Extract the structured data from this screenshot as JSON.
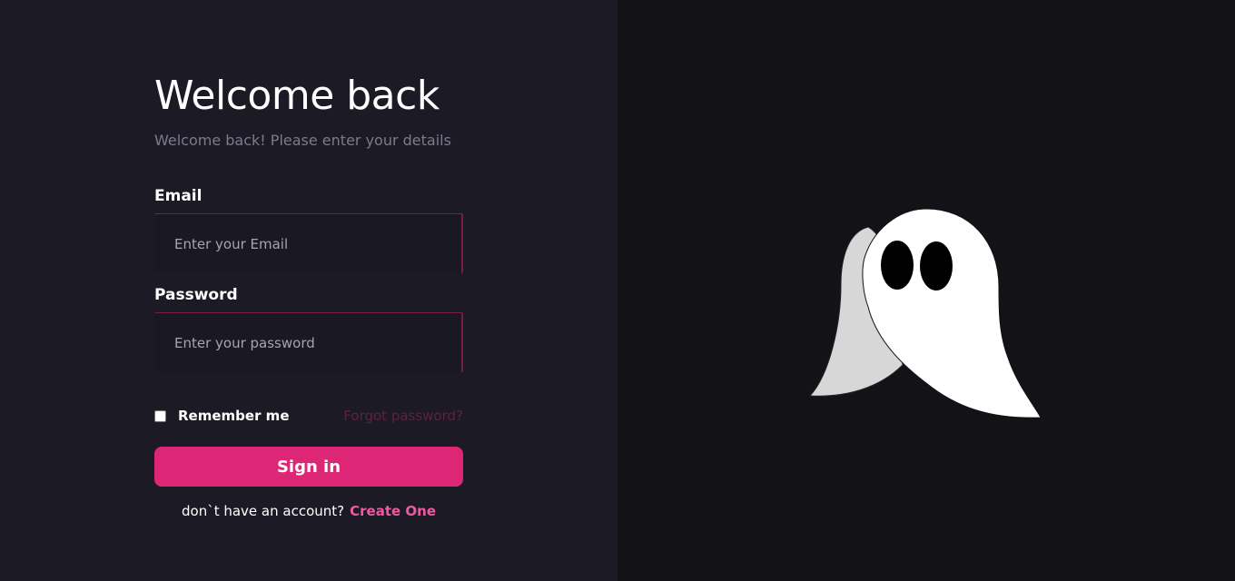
{
  "login": {
    "title": "Welcome back",
    "subtitle": "Welcome back! Please enter your details",
    "email_label": "Email",
    "email_placeholder": "Enter your Email",
    "email_value": "",
    "password_label": "Password",
    "password_placeholder": "Enter your password",
    "password_value": "",
    "remember_label": "Remember me",
    "remember_checked": false,
    "forgot_label": "Forgot password?",
    "signin_label": "Sign in",
    "no_account_text": "don`t have an account?",
    "create_link_label": "Create One"
  },
  "colors": {
    "accent": "#dd2676",
    "link": "#ee5aa0",
    "left_background": "#1c1b25",
    "right_background": "#131217"
  },
  "illustration": {
    "icon": "ghost-illustration"
  }
}
